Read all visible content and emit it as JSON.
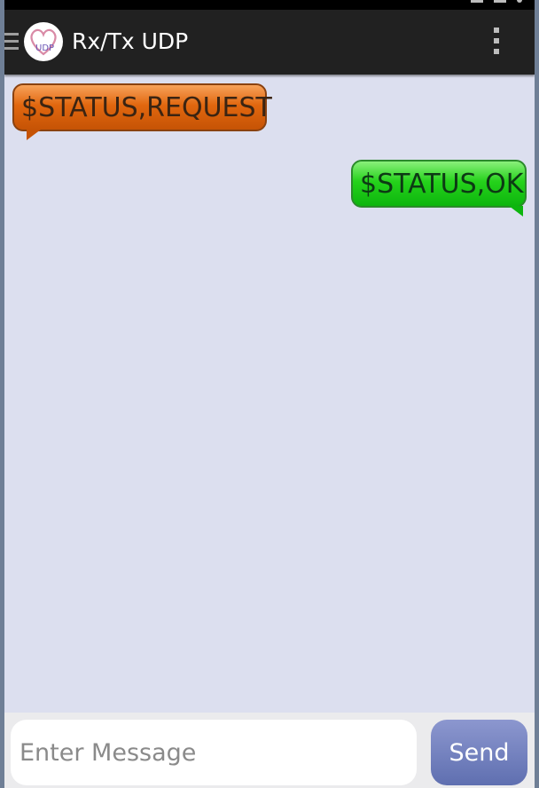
{
  "app": {
    "title": "Rx/Tx UDP",
    "logo_text": "UDP"
  },
  "icons": {
    "menu_toggle": "hamburger-menu-icon",
    "app_logo": "heart-logo-icon",
    "overflow_menu": "vertical-dots-icon"
  },
  "messages": [
    {
      "direction": "received",
      "text": "$STATUS,REQUEST",
      "color": "#e1670f"
    },
    {
      "direction": "sent",
      "text": "$STATUS,OK",
      "color": "#25d21b"
    }
  ],
  "composer": {
    "placeholder": "Enter Message",
    "value": "",
    "send_label": "Send"
  },
  "colors": {
    "actionbar": "#212121",
    "chat_background": "#dcdfef",
    "send_button": "#6f7cbd"
  }
}
